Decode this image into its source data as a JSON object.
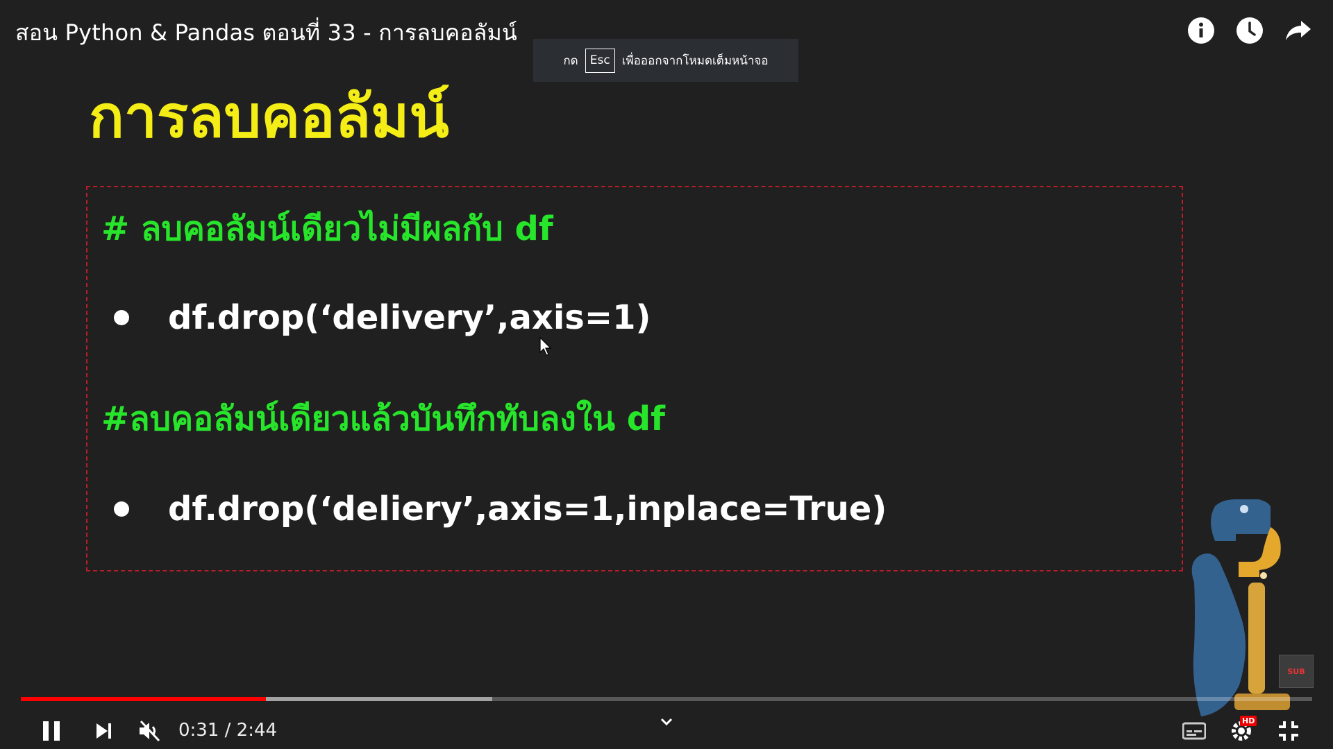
{
  "player": {
    "title": "สอน Python & Pandas ตอนที่ 33 - การลบคอลัมน์",
    "esc_prefix": "กด",
    "esc_key": "Esc",
    "esc_suffix": "เพื่อออกจากโหมดเต็มหน้าจอ",
    "time_display": "0:31 / 2:44",
    "played_fraction": 0.19,
    "buffered_fraction": 0.365,
    "hd_label": "HD",
    "sub_label": "SUB",
    "accent_color": "#ff0000"
  },
  "top_icons": [
    "info-icon",
    "watch-later-icon",
    "share-icon"
  ],
  "slide": {
    "heading": "การลบคอลัมน์",
    "comment_1": "# ลบคอลัมน์เดียวไม่มีผลกับ df",
    "code_1": "df.drop(‘delivery’,axis=1)",
    "comment_2": "#ลบคอลัมน์เดียวแล้วบันทึกทับลงใน df",
    "code_2": "df.drop(‘deliery’,axis=1,inplace=True)",
    "heading_color": "#f4ee16",
    "comment_color": "#27e52a",
    "border_color": "#b51d27"
  },
  "controls": [
    "pause-icon",
    "next-icon",
    "muted-volume-icon",
    "chevron-down-icon",
    "subtitles-icon",
    "settings-icon",
    "exit-fullscreen-icon"
  ]
}
